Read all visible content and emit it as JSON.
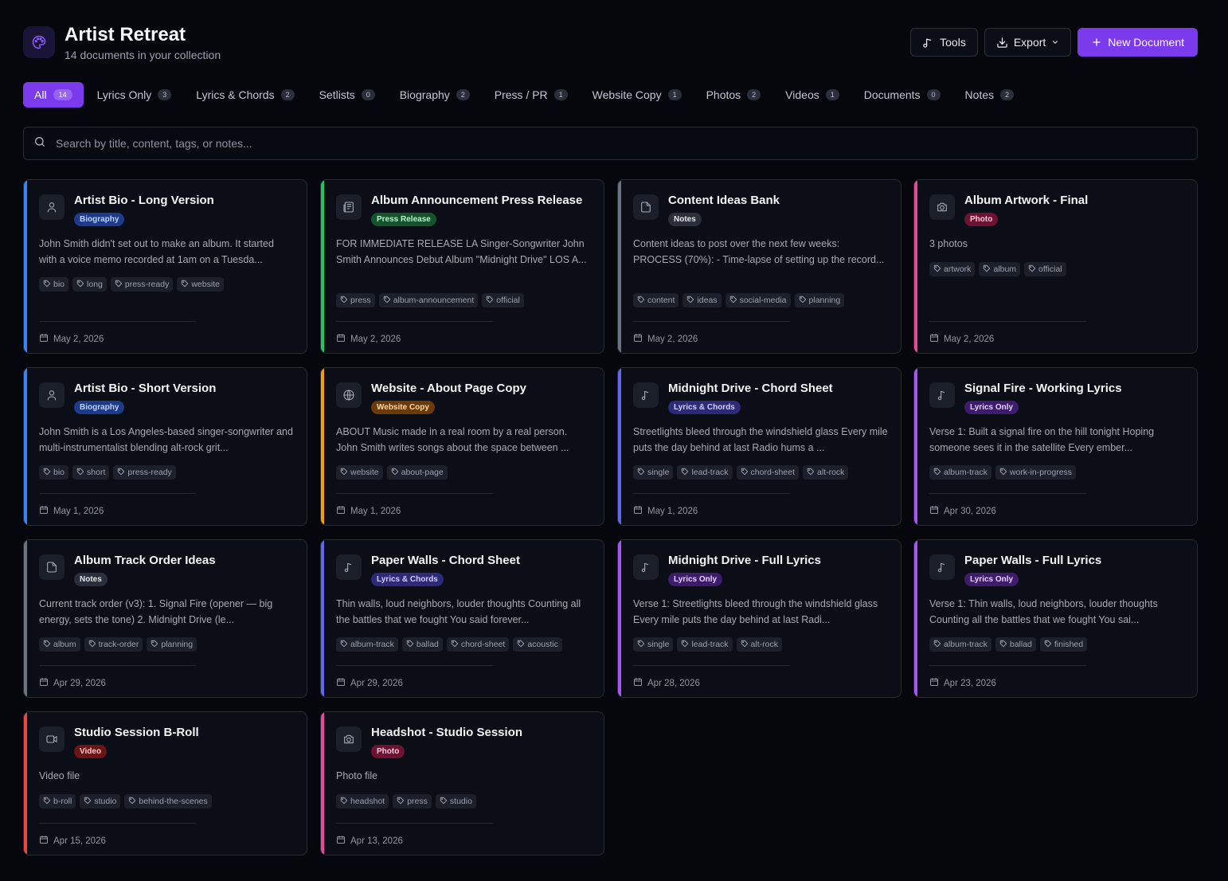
{
  "app": {
    "title": "Artist Retreat",
    "subtitle": "14 documents in your collection",
    "icon": "palette-icon"
  },
  "actions": {
    "tools_label": "Tools",
    "export_label": "Export",
    "new_document_label": "New Document"
  },
  "tabs": [
    {
      "label": "All",
      "count": "14",
      "active": true
    },
    {
      "label": "Lyrics Only",
      "count": "3"
    },
    {
      "label": "Lyrics & Chords",
      "count": "2"
    },
    {
      "label": "Setlists",
      "count": "0"
    },
    {
      "label": "Biography",
      "count": "2"
    },
    {
      "label": "Press / PR",
      "count": "1"
    },
    {
      "label": "Website Copy",
      "count": "1"
    },
    {
      "label": "Photos",
      "count": "2"
    },
    {
      "label": "Videos",
      "count": "1"
    },
    {
      "label": "Documents",
      "count": "0"
    },
    {
      "label": "Notes",
      "count": "2"
    }
  ],
  "search": {
    "placeholder": "Search by title, content, tags, or notes..."
  },
  "colors": {
    "accent": "#7c3aed",
    "biography": "#3b82f6",
    "press": "#22c55e",
    "notes": "#6b7280",
    "photo": "#ec4899",
    "website": "#f59e0b",
    "lyrics_chords": "#6366f1",
    "lyrics_only": "#a855f7",
    "video": "#ef4444"
  },
  "cards": [
    {
      "title": "Artist Bio - Long Version",
      "badge": "Biography",
      "type": "biography",
      "icon": "user-icon",
      "excerpt": "John Smith didn't set out to make an album. It started with a voice memo recorded at 1am on a Tuesda...",
      "tags": [
        "bio",
        "long",
        "press-ready",
        "website"
      ],
      "date": "May 2, 2026"
    },
    {
      "title": "Album Announcement Press Release",
      "badge": "Press Release",
      "type": "press",
      "icon": "newspaper-icon",
      "excerpt": "FOR IMMEDIATE RELEASE LA Singer-Songwriter John Smith Announces Debut Album \"Midnight Drive\" LOS A...",
      "tags": [
        "press",
        "album-announcement",
        "official"
      ],
      "date": "May 2, 2026"
    },
    {
      "title": "Content Ideas Bank",
      "badge": "Notes",
      "type": "notes",
      "icon": "note-icon",
      "excerpt": "Content ideas to post over the next few weeks: PROCESS (70%): - Time-lapse of setting up the record...",
      "tags": [
        "content",
        "ideas",
        "social-media",
        "planning"
      ],
      "date": "May 2, 2026"
    },
    {
      "title": "Album Artwork - Final",
      "badge": "Photo",
      "type": "photo",
      "icon": "camera-icon",
      "excerpt": "3 photos",
      "tags": [
        "artwork",
        "album",
        "official"
      ],
      "date": "May 2, 2026"
    },
    {
      "title": "Artist Bio - Short Version",
      "badge": "Biography",
      "type": "biography",
      "icon": "user-icon",
      "excerpt": "John Smith is a Los Angeles-based singer-songwriter and multi-instrumentalist blending alt-rock grit...",
      "tags": [
        "bio",
        "short",
        "press-ready"
      ],
      "date": "May 1, 2026"
    },
    {
      "title": "Website - About Page Copy",
      "badge": "Website Copy",
      "type": "website",
      "icon": "globe-icon",
      "excerpt": "ABOUT Music made in a real room by a real person. John Smith writes songs about the space between ...",
      "tags": [
        "website",
        "about-page"
      ],
      "date": "May 1, 2026"
    },
    {
      "title": "Midnight Drive - Chord Sheet",
      "badge": "Lyrics & Chords",
      "type": "lyrics_chords",
      "icon": "music-note-icon",
      "excerpt": "Streetlights bleed through the windshield glass Every mile puts the day behind at last Radio hums a ...",
      "tags": [
        "single",
        "lead-track",
        "chord-sheet",
        "alt-rock"
      ],
      "date": "May 1, 2026"
    },
    {
      "title": "Signal Fire - Working Lyrics",
      "badge": "Lyrics Only",
      "type": "lyrics_only",
      "icon": "music-note-icon",
      "excerpt": "Verse 1: Built a signal fire on the hill tonight Hoping someone sees it in the satellite Every ember...",
      "tags": [
        "album-track",
        "work-in-progress"
      ],
      "date": "Apr 30, 2026"
    },
    {
      "title": "Album Track Order Ideas",
      "badge": "Notes",
      "type": "notes",
      "icon": "note-icon",
      "excerpt": "Current track order (v3): 1. Signal Fire (opener — big energy, sets the tone) 2. Midnight Drive (le...",
      "tags": [
        "album",
        "track-order",
        "planning"
      ],
      "date": "Apr 29, 2026"
    },
    {
      "title": "Paper Walls - Chord Sheet",
      "badge": "Lyrics & Chords",
      "type": "lyrics_chords",
      "icon": "music-note-icon",
      "excerpt": "Thin walls, loud neighbors, louder thoughts Counting all the battles that we fought You said forever...",
      "tags": [
        "album-track",
        "ballad",
        "chord-sheet",
        "acoustic"
      ],
      "date": "Apr 29, 2026"
    },
    {
      "title": "Midnight Drive - Full Lyrics",
      "badge": "Lyrics Only",
      "type": "lyrics_only",
      "icon": "music-note-icon",
      "excerpt": "Verse 1: Streetlights bleed through the windshield glass Every mile puts the day behind at last Radi...",
      "tags": [
        "single",
        "lead-track",
        "alt-rock"
      ],
      "date": "Apr 28, 2026"
    },
    {
      "title": "Paper Walls - Full Lyrics",
      "badge": "Lyrics Only",
      "type": "lyrics_only",
      "icon": "music-note-icon",
      "excerpt": "Verse 1: Thin walls, loud neighbors, louder thoughts Counting all the battles that we fought You sai...",
      "tags": [
        "album-track",
        "ballad",
        "finished"
      ],
      "date": "Apr 23, 2026"
    },
    {
      "title": "Studio Session B-Roll",
      "badge": "Video",
      "type": "video",
      "icon": "video-icon",
      "excerpt": "Video file",
      "tags": [
        "b-roll",
        "studio",
        "behind-the-scenes"
      ],
      "date": "Apr 15, 2026"
    },
    {
      "title": "Headshot - Studio Session",
      "badge": "Photo",
      "type": "photo",
      "icon": "camera-icon",
      "excerpt": "Photo file",
      "tags": [
        "headshot",
        "press",
        "studio"
      ],
      "date": "Apr 13, 2026"
    }
  ]
}
